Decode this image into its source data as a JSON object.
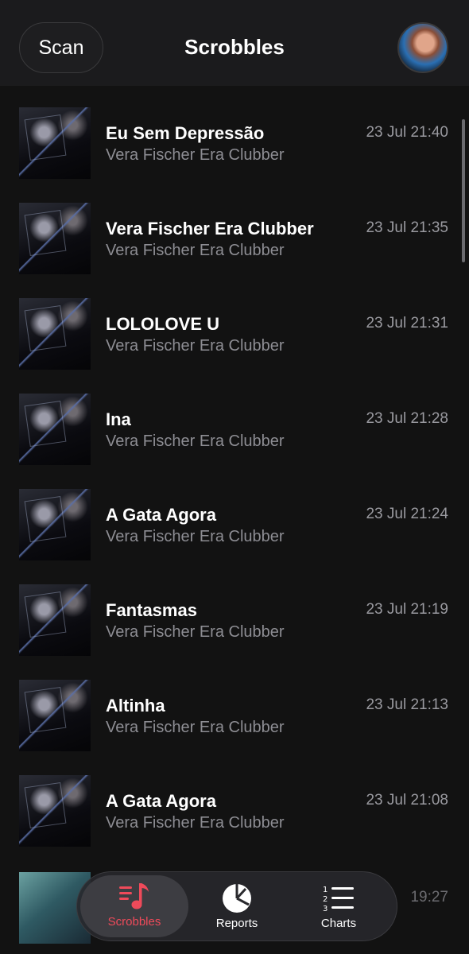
{
  "header": {
    "scan_label": "Scan",
    "title": "Scrobbles"
  },
  "scrobbles": [
    {
      "track": "Eu Sem Depressão",
      "artist": "Vera Fischer Era Clubber",
      "time": "23 Jul 21:40"
    },
    {
      "track": "Vera Fischer Era Clubber",
      "artist": "Vera Fischer Era Clubber",
      "time": "23 Jul 21:35"
    },
    {
      "track": "LOLOLOVE U",
      "artist": "Vera Fischer Era Clubber",
      "time": "23 Jul 21:31"
    },
    {
      "track": "Ina",
      "artist": "Vera Fischer Era Clubber",
      "time": "23 Jul 21:28"
    },
    {
      "track": "A Gata Agora",
      "artist": "Vera Fischer Era Clubber",
      "time": "23 Jul 21:24"
    },
    {
      "track": "Fantasmas",
      "artist": "Vera Fischer Era Clubber",
      "time": "23 Jul 21:19"
    },
    {
      "track": "Altinha",
      "artist": "Vera Fischer Era Clubber",
      "time": "23 Jul 21:13"
    },
    {
      "track": "A Gata Agora",
      "artist": "Vera Fischer Era Clubber",
      "time": "23 Jul 21:08"
    }
  ],
  "partial_row": {
    "time": "19:27"
  },
  "tabs": [
    {
      "label": "Scrobbles",
      "icon": "music-list-icon",
      "active": true
    },
    {
      "label": "Reports",
      "icon": "pie-chart-icon",
      "active": false
    },
    {
      "label": "Charts",
      "icon": "numbered-list-icon",
      "active": false
    }
  ],
  "colors": {
    "accent": "#ef4a5a",
    "background": "#121212",
    "secondary_text": "#8d8d93"
  }
}
